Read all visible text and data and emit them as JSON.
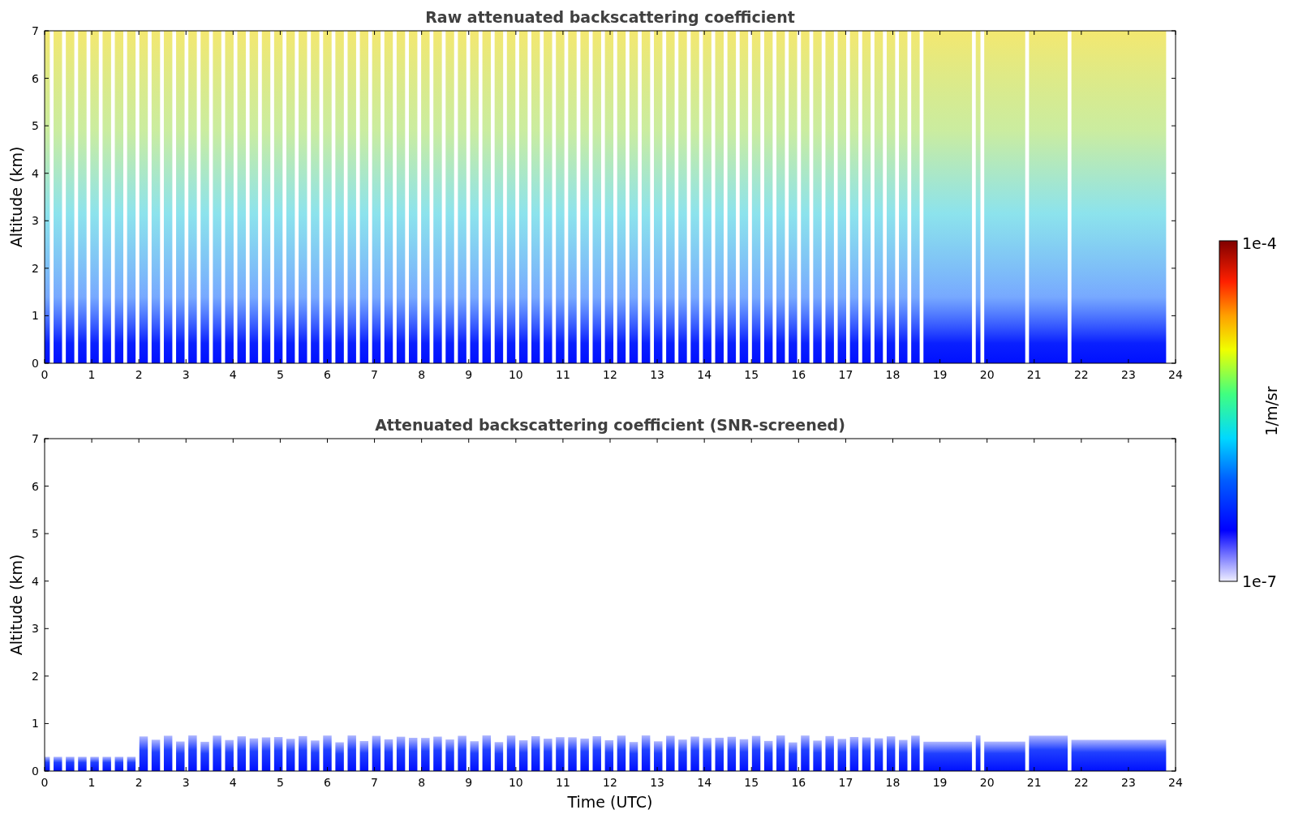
{
  "panels": [
    {
      "title": "Raw attenuated backscattering coefficient",
      "kind": "raw",
      "ylabel": "Altitude (km)",
      "yticks": [
        "7",
        "6",
        "5",
        "4",
        "3",
        "2",
        "1",
        "0"
      ],
      "xticks": [
        "0",
        "1",
        "2",
        "3",
        "4",
        "5",
        "6",
        "7",
        "8",
        "9",
        "10",
        "11",
        "12",
        "13",
        "14",
        "15",
        "16",
        "17",
        "18",
        "19",
        "20",
        "21",
        "22",
        "23",
        "24"
      ]
    },
    {
      "title": "Attenuated backscattering coefficient (SNR-screened)",
      "kind": "screened",
      "ylabel": "Altitude (km)",
      "yticks": [
        "7",
        "6",
        "5",
        "4",
        "3",
        "2",
        "1",
        "0"
      ],
      "xticks": [
        "0",
        "1",
        "2",
        "3",
        "4",
        "5",
        "6",
        "7",
        "8",
        "9",
        "10",
        "11",
        "12",
        "13",
        "14",
        "15",
        "16",
        "17",
        "18",
        "19",
        "20",
        "21",
        "22",
        "23",
        "24"
      ],
      "xlabel": "Time (UTC)"
    }
  ],
  "colorbar": {
    "max_label": "1e-4",
    "min_label": "1e-7",
    "unit": "1/m/sr"
  }
}
